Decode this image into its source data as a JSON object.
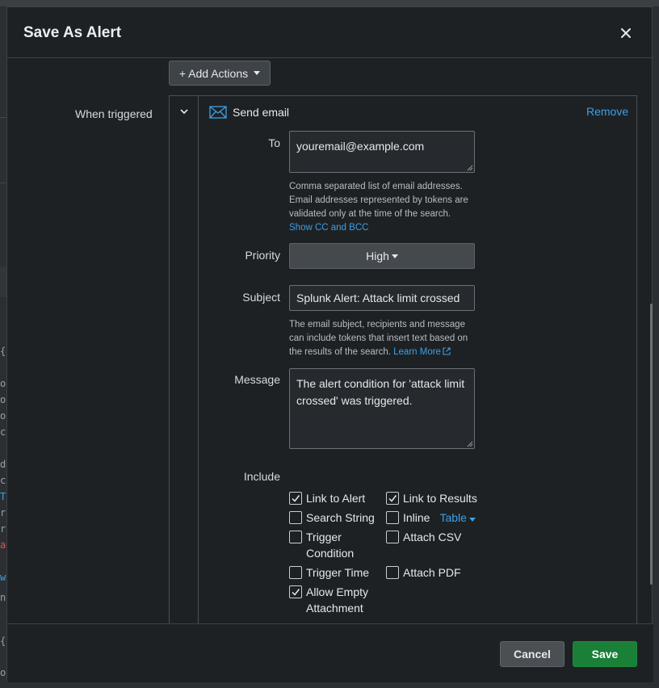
{
  "modal": {
    "title": "Save As Alert"
  },
  "add_actions_label": "+ Add Actions",
  "when_triggered_label": "When triggered",
  "action": {
    "name": "Send email",
    "remove_label": "Remove",
    "to": {
      "label": "To",
      "value": "youremail@example.com",
      "help_line1": "Comma separated list of email addresses.",
      "help_line2": "Email addresses represented by tokens are",
      "help_line3": "validated only at the time of the search.",
      "cc_link": "Show CC and BCC"
    },
    "priority": {
      "label": "Priority",
      "value": "High"
    },
    "subject": {
      "label": "Subject",
      "value": "Splunk Alert: Attack limit crossed",
      "help_line1": "The email subject, recipients and message",
      "help_line2": "can include tokens that insert text based on",
      "help_line3": "the results of the search.",
      "learn_more": "Learn More"
    },
    "message": {
      "label": "Message",
      "value": "The alert condition for 'attack limit crossed' was triggered."
    },
    "include": {
      "label": "Include",
      "link_to_alert": "Link to Alert",
      "link_to_results": "Link to Results",
      "search_string": "Search String",
      "inline": "Inline",
      "inline_format": "Table",
      "trigger_condition_1": "Trigger",
      "trigger_condition_2": "Condition",
      "attach_csv": "Attach CSV",
      "trigger_time": "Trigger Time",
      "attach_pdf": "Attach PDF",
      "allow_empty_1": "Allow Empty",
      "allow_empty_2": "Attachment"
    }
  },
  "footer": {
    "cancel_label": "Cancel",
    "save_label": "Save"
  },
  "background_fragments": [
    "{",
    "o:",
    "or",
    "o",
    "c",
    "d:",
    "ce",
    "T",
    "r",
    "rt",
    "an",
    "w",
    "nn",
    "{",
    "o:"
  ]
}
